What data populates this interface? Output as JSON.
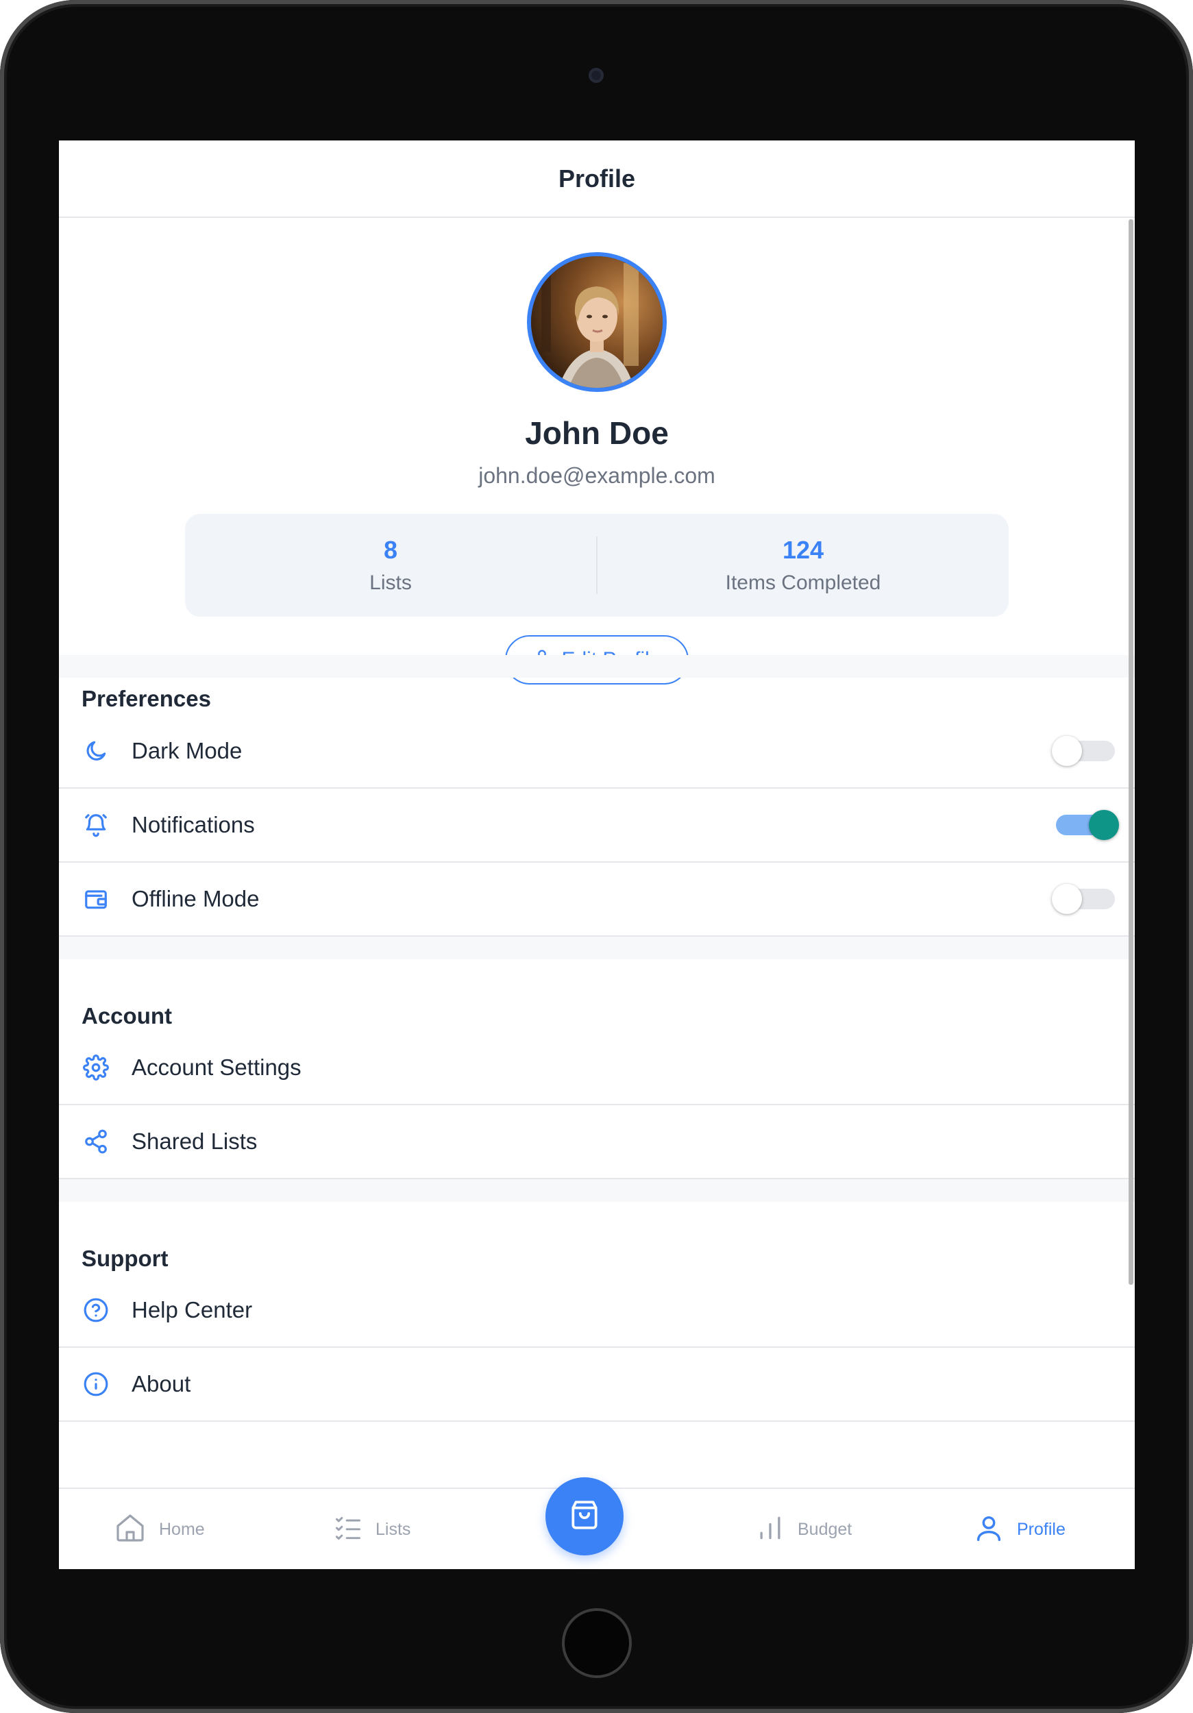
{
  "header": {
    "title": "Profile"
  },
  "profile": {
    "name": "John Doe",
    "email": "john.doe@example.com",
    "stats": [
      {
        "value": "8",
        "label": "Lists"
      },
      {
        "value": "124",
        "label": "Items Completed"
      }
    ],
    "edit_label": "Edit Profile"
  },
  "preferences": {
    "title": "Preferences",
    "items": [
      {
        "label": "Dark Mode",
        "icon": "moon-icon",
        "enabled": false
      },
      {
        "label": "Notifications",
        "icon": "bell-icon",
        "enabled": true
      },
      {
        "label": "Offline Mode",
        "icon": "wallet-icon",
        "enabled": false
      }
    ]
  },
  "account": {
    "title": "Account",
    "items": [
      {
        "label": "Account Settings",
        "icon": "gear-icon"
      },
      {
        "label": "Shared Lists",
        "icon": "share-icon"
      }
    ]
  },
  "support": {
    "title": "Support",
    "items": [
      {
        "label": "Help Center",
        "icon": "help-icon"
      },
      {
        "label": "About",
        "icon": "info-icon"
      }
    ]
  },
  "nav": {
    "items": [
      {
        "label": "Home",
        "icon": "home-icon",
        "active": false
      },
      {
        "label": "Lists",
        "icon": "checklist-icon",
        "active": false
      },
      {
        "label": "Budget",
        "icon": "bar-chart-icon",
        "active": false
      },
      {
        "label": "Profile",
        "icon": "user-icon",
        "active": true
      }
    ],
    "fab_icon": "shopping-bag-icon"
  },
  "colors": {
    "accent": "#3b82f6",
    "text_primary": "#1f2937",
    "text_muted": "#6b7280",
    "toggle_on_knob": "#0f9488",
    "toggle_on_track": "#7db3f5"
  }
}
